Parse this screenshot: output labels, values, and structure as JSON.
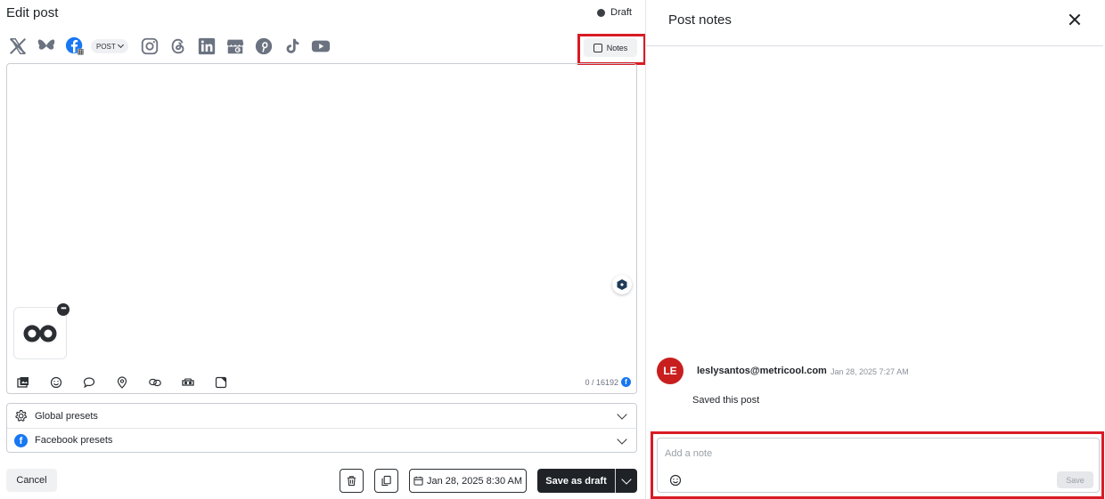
{
  "editor": {
    "title": "Edit post",
    "status": "Draft",
    "networks": [
      {
        "name": "x-icon"
      },
      {
        "name": "bluesky-icon"
      },
      {
        "name": "facebook-icon",
        "selected": true
      },
      {
        "name": "instagram-icon"
      },
      {
        "name": "threads-icon"
      },
      {
        "name": "linkedin-icon"
      },
      {
        "name": "google-business-icon"
      },
      {
        "name": "pinterest-icon"
      },
      {
        "name": "tiktok-icon"
      },
      {
        "name": "youtube-icon"
      }
    ],
    "post_type": "POST",
    "notes_label": "Notes",
    "char_counter": "0 / 16192",
    "presets": {
      "global": "Global presets",
      "facebook": "Facebook presets"
    },
    "actions": {
      "cancel": "Cancel",
      "date": "Jan 28, 2025 8:30 AM",
      "save_draft": "Save as draft"
    }
  },
  "notes_panel": {
    "title": "Post notes",
    "note": {
      "initials": "LE",
      "author": "leslysantos@metricool.com",
      "time": "Jan 28, 2025 7:27 AM",
      "text": "Saved this post"
    },
    "input": {
      "placeholder": "Add a note",
      "save_label": "Save"
    }
  },
  "colors": {
    "accent_dark": "#1f2328",
    "facebook_blue": "#1877f2",
    "highlight_red": "#d81b25",
    "avatar_red": "#c81e1e"
  }
}
